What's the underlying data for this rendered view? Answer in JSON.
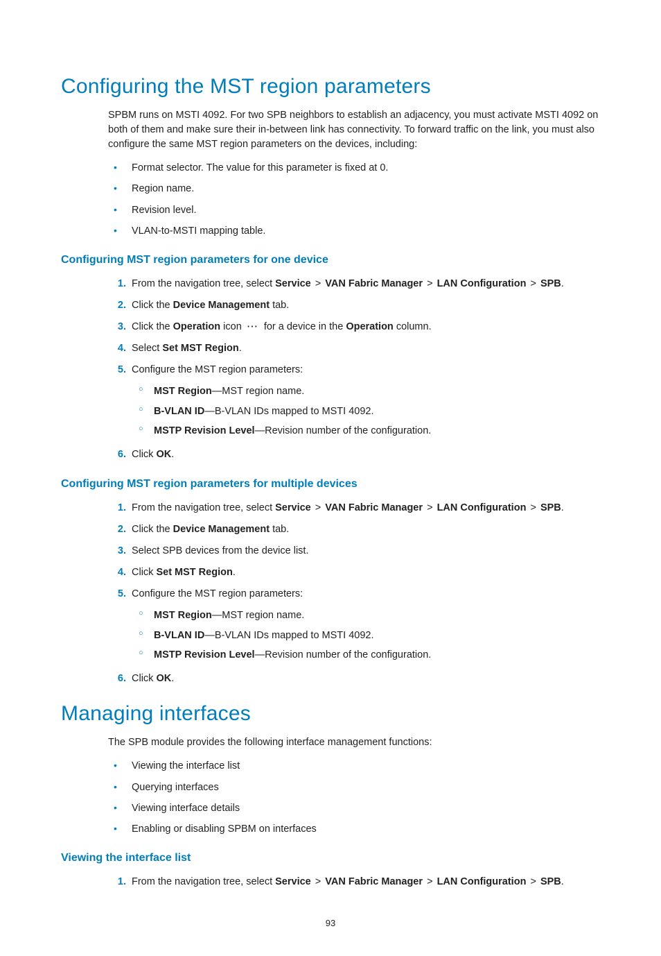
{
  "h1_a": "Configuring the MST region parameters",
  "intro": "SPBM runs on MSTI 4092. For two SPB neighbors to establish an adjacency, you must activate MSTI 4092 on both of them and make sure their in-between link has connectivity. To forward traffic on the link, you must also configure the same MST region parameters on the devices, including:",
  "bullets_a": [
    "Format selector. The value for this parameter is fixed at 0.",
    "Region name.",
    "Revision level.",
    "VLAN-to-MSTI mapping table."
  ],
  "h2_a": "Configuring MST region parameters for one device",
  "nav": {
    "prefix": "From the navigation tree, select ",
    "service": "Service",
    "vfm": "VAN Fabric Manager",
    "lan": "LAN Configuration",
    "spb": "SPB",
    "sep": ">",
    "suffix": "."
  },
  "step_click_dm_a": "Click the ",
  "step_click_dm_b": "Device Management",
  "step_click_dm_c": " tab.",
  "op": {
    "a": "Click the ",
    "b": "Operation",
    "c": " icon ",
    "glyph": "···",
    "glyph_name": "operation-icon",
    "d": " for a device in the ",
    "e": "Operation",
    "f": " column."
  },
  "select_smr_a": "Select ",
  "select_smr_b": "Set MST Region",
  "select_smr_c": ".",
  "cfg_params": "Configure the MST region parameters:",
  "sub": {
    "mr_b": "MST Region",
    "mr_t": "—MST region name.",
    "bv_b": "B-VLAN ID",
    "bv_t": "—B-VLAN IDs mapped to MSTI 4092.",
    "rl_b": "MSTP Revision Level",
    "rl_t": "—Revision number of the configuration."
  },
  "click_ok_a": "Click ",
  "click_ok_b": "OK",
  "click_ok_c": ".",
  "h2_b": "Configuring MST region parameters for multiple devices",
  "step_b3": "Select SPB devices from the device list.",
  "click_smr_a": "Click ",
  "click_smr_b": "Set MST Region",
  "click_smr_c": ".",
  "h1_b": "Managing interfaces",
  "intro_b": "The SPB module provides the following interface management functions:",
  "bullets_b": [
    "Viewing the interface list",
    "Querying interfaces",
    "Viewing interface details",
    "Enabling or disabling SPBM on interfaces"
  ],
  "h2_c": "Viewing the interface list",
  "page_number": "93"
}
